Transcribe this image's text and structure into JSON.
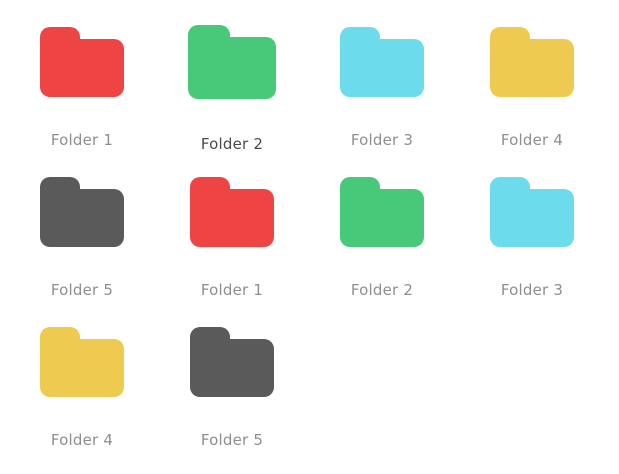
{
  "folders": [
    {
      "label": "Folder 1",
      "color": "#ef4444",
      "icon": "folder-icon",
      "state": "normal"
    },
    {
      "label": "Folder 2",
      "color": "#48c97a",
      "icon": "folder-icon",
      "state": "hover"
    },
    {
      "label": "Folder 3",
      "color": "#6cdcec",
      "icon": "folder-icon",
      "state": "normal"
    },
    {
      "label": "Folder 4",
      "color": "#eeca50",
      "icon": "folder-icon",
      "state": "normal"
    },
    {
      "label": "Folder 5",
      "color": "#5a5a5a",
      "icon": "folder-icon",
      "state": "normal"
    },
    {
      "label": "Folder 1",
      "color": "#ef4444",
      "icon": "folder-icon",
      "state": "normal"
    },
    {
      "label": "Folder 2",
      "color": "#48c97a",
      "icon": "folder-icon",
      "state": "normal"
    },
    {
      "label": "Folder 3",
      "color": "#6cdcec",
      "icon": "folder-icon",
      "state": "normal"
    },
    {
      "label": "Folder 4",
      "color": "#eeca50",
      "icon": "folder-icon",
      "state": "normal"
    },
    {
      "label": "Folder 5",
      "color": "#5a5a5a",
      "icon": "folder-icon",
      "state": "normal"
    }
  ]
}
